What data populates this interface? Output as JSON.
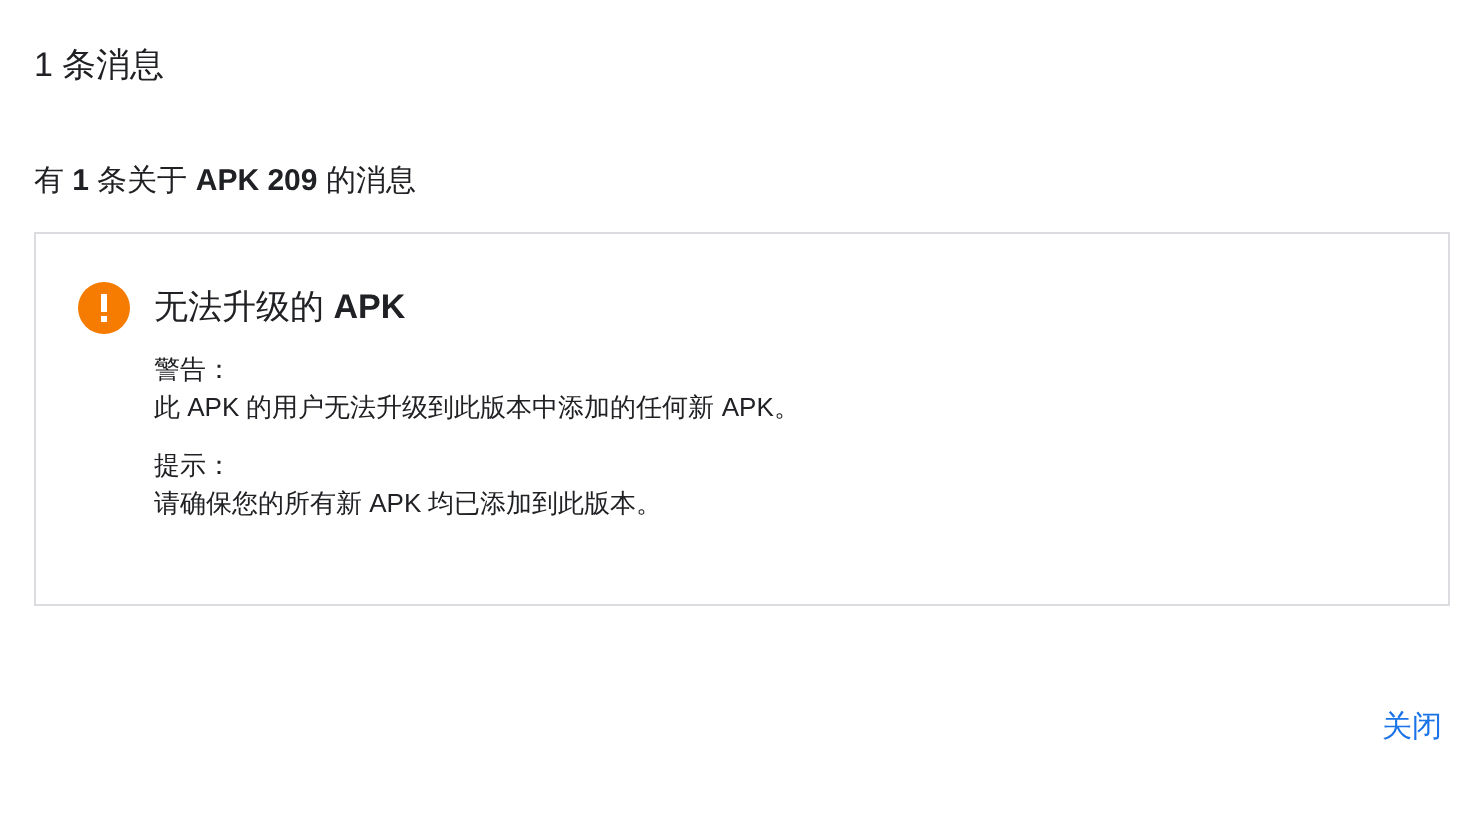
{
  "title": "1 条消息",
  "summary": "有 **1** 条关于 **APK 209** 的消息",
  "messages": [
    {
      "kind": "warning",
      "heading": "无法升级的 **APK**",
      "sections": [
        {
          "label": "警告：",
          "text": "此 APK 的用户无法升级到此版本中添加的任何新 APK。"
        },
        {
          "label": "提示：",
          "text": "请确保您的所有新 APK 均已添加到此版本。"
        }
      ]
    }
  ],
  "close_button": "关闭"
}
